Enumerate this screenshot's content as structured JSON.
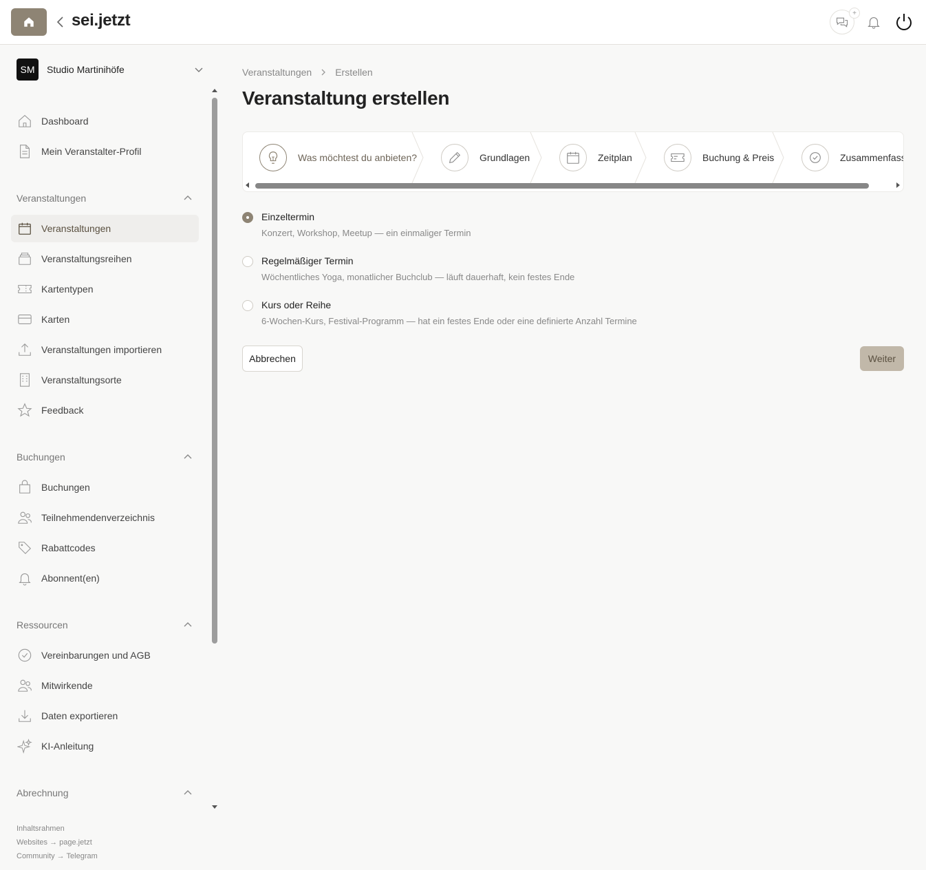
{
  "brand": "sei.jetzt",
  "topbar": {
    "home_icon": "home-icon",
    "chat_plus": "+"
  },
  "org": {
    "initials": "SM",
    "name": "Studio Martinihöfe"
  },
  "sidebar": {
    "top_items": [
      {
        "label": "Dashboard",
        "icon": "home-icon"
      },
      {
        "label": "Mein Veranstalter-Profil",
        "icon": "document-icon"
      }
    ],
    "sections": [
      {
        "title": "Veranstaltungen",
        "items": [
          {
            "label": "Veranstaltungen",
            "icon": "calendar-icon",
            "active": true
          },
          {
            "label": "Veranstaltungsreihen",
            "icon": "stack-icon"
          },
          {
            "label": "Kartentypen",
            "icon": "ticket-icon"
          },
          {
            "label": "Karten",
            "icon": "card-icon"
          },
          {
            "label": "Veranstaltungen importieren",
            "icon": "upload-icon"
          },
          {
            "label": "Veranstaltungsorte",
            "icon": "building-icon"
          },
          {
            "label": "Feedback",
            "icon": "star-icon"
          }
        ]
      },
      {
        "title": "Buchungen",
        "items": [
          {
            "label": "Buchungen",
            "icon": "bag-icon"
          },
          {
            "label": "Teilnehmendenverzeichnis",
            "icon": "users-icon"
          },
          {
            "label": "Rabattcodes",
            "icon": "tag-icon"
          },
          {
            "label": "Abonnent(en)",
            "icon": "bell-icon"
          }
        ]
      },
      {
        "title": "Ressourcen",
        "items": [
          {
            "label": "Vereinbarungen und AGB",
            "icon": "check-circle-icon"
          },
          {
            "label": "Mitwirkende",
            "icon": "users-icon"
          },
          {
            "label": "Daten exportieren",
            "icon": "download-icon"
          },
          {
            "label": "KI-Anleitung",
            "icon": "sparkle-icon"
          }
        ]
      },
      {
        "title": "Abrechnung",
        "items": []
      }
    ],
    "footer": [
      "Inhaltsrahmen",
      "Websites → page.jetzt",
      "Community → Telegram"
    ]
  },
  "breadcrumb": [
    "Veranstaltungen",
    "Erstellen"
  ],
  "page_title": "Veranstaltung erstellen",
  "steps": [
    {
      "label": "Was möchtest du anbieten?",
      "icon": "lightbulb-icon",
      "current": true
    },
    {
      "label": "Grundlagen",
      "icon": "pencil-icon"
    },
    {
      "label": "Zeitplan",
      "icon": "calendar-icon"
    },
    {
      "label": "Buchung & Preis",
      "icon": "ticket-icon"
    },
    {
      "label": "Zusammenfassung",
      "icon": "check-circle-icon"
    }
  ],
  "options": [
    {
      "title": "Einzeltermin",
      "desc": "Konzert, Workshop, Meetup — ein einmaliger Termin",
      "checked": true
    },
    {
      "title": "Regelmäßiger Termin",
      "desc": "Wöchentliches Yoga, monatlicher Buchclub — läuft dauerhaft, kein festes Ende",
      "checked": false
    },
    {
      "title": "Kurs oder Reihe",
      "desc": "6-Wochen-Kurs, Festival-Programm — hat ein festes Ende oder eine definierte Anzahl Termine",
      "checked": false
    }
  ],
  "buttons": {
    "cancel": "Abbrechen",
    "next": "Weiter"
  },
  "colors": {
    "accent": "#8e8474",
    "next_button": "#c1b8a9",
    "active_nav_bg": "#efeeec"
  }
}
